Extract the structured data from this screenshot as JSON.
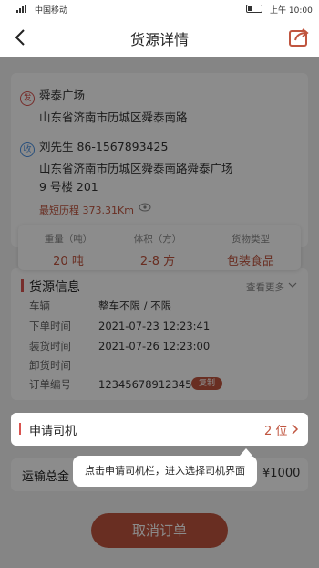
{
  "status_bar": {
    "carrier": "中国移动",
    "time": "上午 10:00"
  },
  "nav": {
    "title": "货源详情"
  },
  "shipment": {
    "sender_tag": "发",
    "sender_name": "舜泰广场",
    "sender_address": "山东省济南市历城区舜泰南路",
    "receiver_tag": "收",
    "receiver_contact": "刘先生  86-1567893425",
    "receiver_address_line1": "山东省济南市历城区舜泰南路舜泰广场",
    "receiver_address_line2": "9 号楼 201",
    "route": "最短历程 373.31Km"
  },
  "stats": [
    {
      "label": "重量（吨）",
      "value": "20 吨"
    },
    {
      "label": "体积（方）",
      "value": "2-8 方"
    },
    {
      "label": "货物类型",
      "value": "包装食品"
    }
  ],
  "cargo_info": {
    "heading": "货源信息",
    "more_label": "查看更多",
    "rows": [
      {
        "key": "车辆",
        "value": "整车不限 / 不限"
      },
      {
        "key": "下单时间",
        "value": "2021-07-23 12:23:41"
      },
      {
        "key": "装货时间",
        "value": "2021-07-26 12:23:00"
      },
      {
        "key": "卸货时间",
        "value": ""
      },
      {
        "key": "订单编号",
        "value": "12345678912345"
      }
    ],
    "copy_label": "复制"
  },
  "driver": {
    "label": "申请司机",
    "count": "2 位"
  },
  "total": {
    "label": "运输总金",
    "amount": "¥1000"
  },
  "tooltip": "点击申请司机栏，进入选择司机界面",
  "cancel_button": "取消订单",
  "colors": {
    "accent": "#c0553f",
    "overlay": "rgba(0,0,0,0.45)"
  }
}
